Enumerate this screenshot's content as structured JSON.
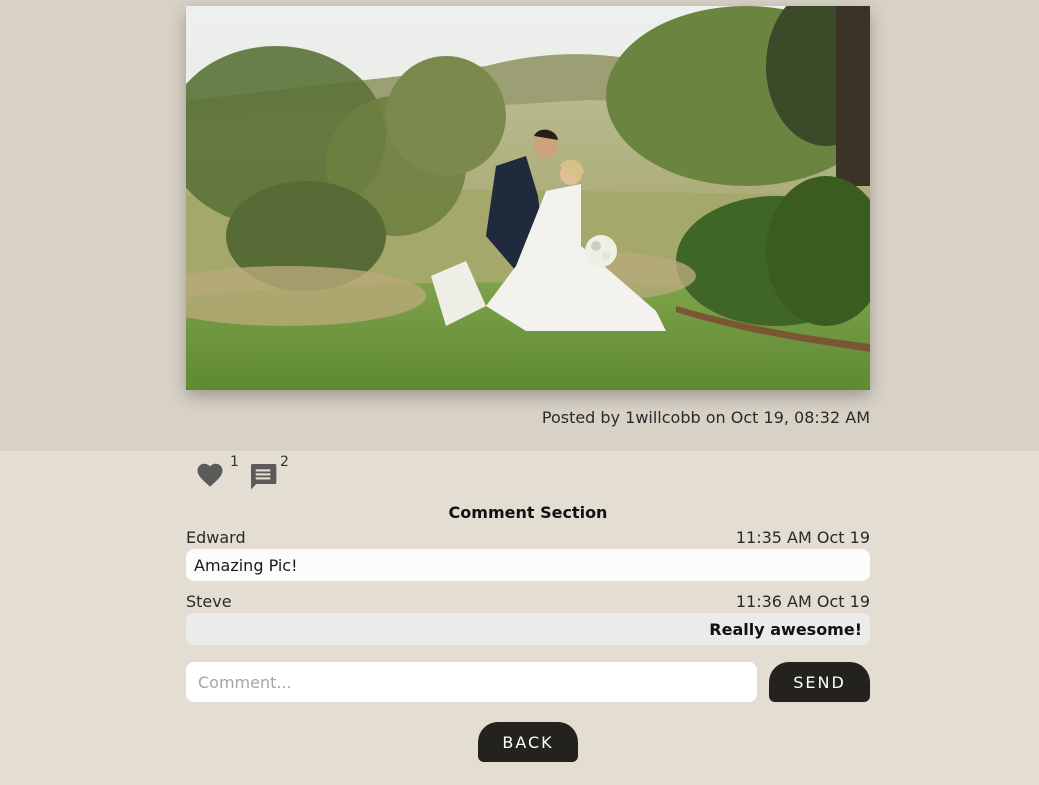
{
  "post": {
    "author": "1willcobb",
    "posted_label": "Posted by",
    "on_label": "on",
    "date": "Oct 19, 08:32 AM"
  },
  "reactions": {
    "likes_count": "1",
    "comments_count": "2"
  },
  "comments_section": {
    "title": "Comment Section",
    "items": [
      {
        "author": "Edward",
        "time": "11:35 AM Oct 19",
        "text": "Amazing Pic!"
      },
      {
        "author": "Steve",
        "time": "11:36 AM Oct 19",
        "text": "Really awesome!"
      }
    ]
  },
  "comment_form": {
    "placeholder": "Comment...",
    "value": "",
    "send_label": "SEND"
  },
  "nav": {
    "back_label": "BACK"
  },
  "icons": {
    "like": "heart-icon",
    "comments": "comment-icon"
  },
  "colors": {
    "background": "#e3ddd2",
    "top_band": "#d8d2c6",
    "button": "#24221f",
    "icon": "#5a5a5a"
  }
}
